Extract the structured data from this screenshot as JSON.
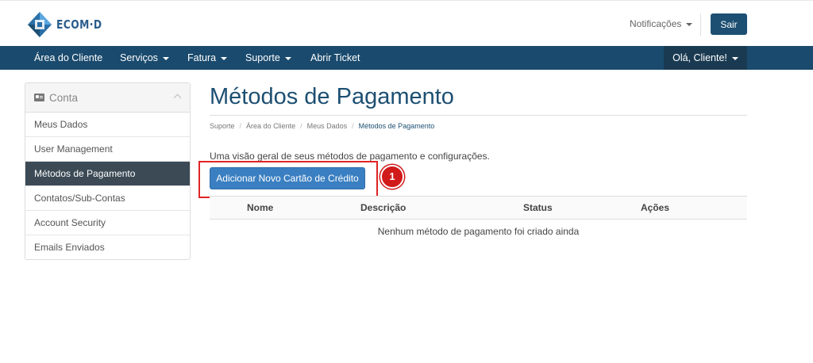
{
  "brand": {
    "logo_text": "ECOM·D"
  },
  "header": {
    "notifications_label": "Notificações",
    "logout_label": "Sair"
  },
  "nav": {
    "items": [
      {
        "label": "Área do Cliente",
        "has_dropdown": false
      },
      {
        "label": "Serviços",
        "has_dropdown": true
      },
      {
        "label": "Fatura",
        "has_dropdown": true
      },
      {
        "label": "Suporte",
        "has_dropdown": true
      },
      {
        "label": "Abrir Ticket",
        "has_dropdown": false
      }
    ],
    "user_label": "Olá, Cliente!"
  },
  "sidebar": {
    "title": "Conta",
    "items": [
      {
        "label": "Meus Dados"
      },
      {
        "label": "User Management"
      },
      {
        "label": "Métodos de Pagamento",
        "active": true
      },
      {
        "label": "Contatos/Sub-Contas"
      },
      {
        "label": "Account Security"
      },
      {
        "label": "Emails Enviados"
      }
    ]
  },
  "main": {
    "title": "Métodos de Pagamento",
    "breadcrumb": [
      "Suporte",
      "Área do Cliente",
      "Meus Dados",
      "Métodos de Pagamento"
    ],
    "overview_text": "Uma visão geral de seus métodos de pagamento e configurações.",
    "add_button_label": "Adicionar Novo Cartão de Crédito",
    "step_badge": "1",
    "table": {
      "headers": [
        "Nome",
        "Descrição",
        "Status",
        "Ações"
      ],
      "empty_message": "Nenhum método de pagamento foi criado ainda"
    }
  },
  "colors": {
    "brand_dark": "#1d4f72",
    "nav_bg": "#1a4a6d",
    "active_sidebar": "#3b4a55",
    "primary_button": "#3a7fc1",
    "annotation_red": "#e02424"
  }
}
